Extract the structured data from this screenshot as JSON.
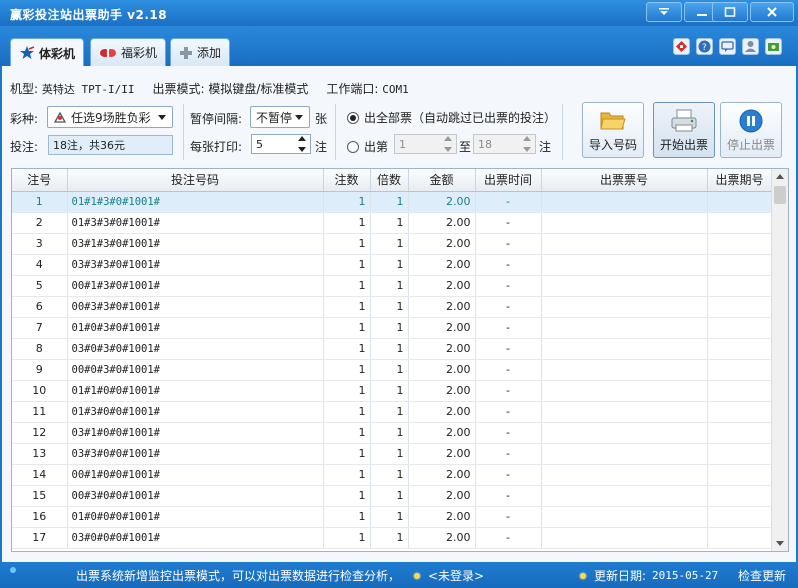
{
  "window": {
    "title": "赢彩投注站出票助手 v2.18"
  },
  "tabs": [
    {
      "label": "体彩机",
      "active": true
    },
    {
      "label": "福彩机",
      "active": false
    },
    {
      "label": "添加",
      "active": false
    }
  ],
  "info": {
    "model_label": "机型:",
    "model_value": "英特达 TPT-I/II",
    "mode_label": "出票模式:",
    "mode_value": "模拟键盘/标准模式",
    "port_label": "工作端口:",
    "port_value": "COM1"
  },
  "controls": {
    "lottery_label": "彩种:",
    "lottery_value": "任选9场胜负彩",
    "bet_label": "投注:",
    "bet_value": "18注，共36元",
    "pause_label": "暂停间隔:",
    "pause_value": "不暂停",
    "pause_unit": "张",
    "print_label": "每张打印:",
    "print_value": "5",
    "print_unit": "注",
    "radio_all": "出全部票（自动跳过已出票的投注）",
    "radio_range_prefix": "出第",
    "range_from": "1",
    "range_to_label": "至",
    "range_to": "18",
    "range_suffix": "注"
  },
  "buttons": {
    "import": "导入号码",
    "start": "开始出票",
    "stop": "停止出票"
  },
  "table": {
    "columns": [
      "注号",
      "投注号码",
      "注数",
      "倍数",
      "金额",
      "出票时间",
      "出票票号",
      "出票期号"
    ],
    "rows": [
      [
        "1",
        "01#1#3#0#1001#",
        "1",
        "1",
        "2.00",
        "-",
        "",
        ""
      ],
      [
        "2",
        "01#3#3#0#1001#",
        "1",
        "1",
        "2.00",
        "-",
        "",
        ""
      ],
      [
        "3",
        "03#1#3#0#1001#",
        "1",
        "1",
        "2.00",
        "-",
        "",
        ""
      ],
      [
        "4",
        "03#3#3#0#1001#",
        "1",
        "1",
        "2.00",
        "-",
        "",
        ""
      ],
      [
        "5",
        "00#1#3#0#1001#",
        "1",
        "1",
        "2.00",
        "-",
        "",
        ""
      ],
      [
        "6",
        "00#3#3#0#1001#",
        "1",
        "1",
        "2.00",
        "-",
        "",
        ""
      ],
      [
        "7",
        "01#0#3#0#1001#",
        "1",
        "1",
        "2.00",
        "-",
        "",
        ""
      ],
      [
        "8",
        "03#0#3#0#1001#",
        "1",
        "1",
        "2.00",
        "-",
        "",
        ""
      ],
      [
        "9",
        "00#0#3#0#1001#",
        "1",
        "1",
        "2.00",
        "-",
        "",
        ""
      ],
      [
        "10",
        "01#1#0#0#1001#",
        "1",
        "1",
        "2.00",
        "-",
        "",
        ""
      ],
      [
        "11",
        "01#3#0#0#1001#",
        "1",
        "1",
        "2.00",
        "-",
        "",
        ""
      ],
      [
        "12",
        "03#1#0#0#1001#",
        "1",
        "1",
        "2.00",
        "-",
        "",
        ""
      ],
      [
        "13",
        "03#3#0#0#1001#",
        "1",
        "1",
        "2.00",
        "-",
        "",
        ""
      ],
      [
        "14",
        "00#1#0#0#1001#",
        "1",
        "1",
        "2.00",
        "-",
        "",
        ""
      ],
      [
        "15",
        "00#3#0#0#1001#",
        "1",
        "1",
        "2.00",
        "-",
        "",
        ""
      ],
      [
        "16",
        "01#0#0#0#1001#",
        "1",
        "1",
        "2.00",
        "-",
        "",
        ""
      ],
      [
        "17",
        "03#0#0#0#1001#",
        "1",
        "1",
        "2.00",
        "-",
        "",
        ""
      ]
    ],
    "selected_row": 0
  },
  "status": {
    "message": "出票系统新增监控出票模式，可以对出票数据进行检查分析，",
    "login": "<未登录>",
    "update_label": "更新日期:",
    "update_date": "2015-05-27",
    "check_update": "检查更新"
  },
  "colors": {
    "titlebar": "#1b6fc3",
    "panel": "#f4f7fb",
    "selected_row_text": "#1a7f86"
  }
}
